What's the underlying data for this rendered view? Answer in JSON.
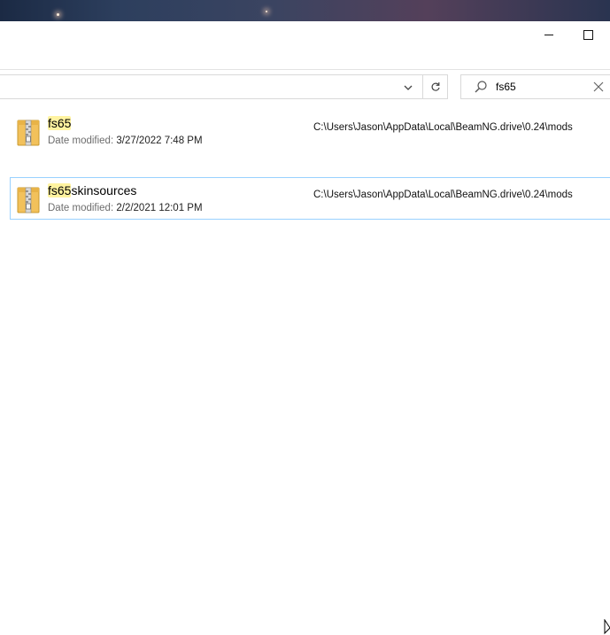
{
  "colors": {
    "highlight": "#fff3a0",
    "selection_border": "#99d1ff",
    "label_gray": "#6d6d6d"
  },
  "window_controls": {
    "minimize_icon": "minimize-icon",
    "maximize_icon": "maximize-icon"
  },
  "address_bar": {
    "chevron_icon": "chevron-down-icon",
    "refresh_icon": "refresh-icon"
  },
  "search": {
    "value": "fs65",
    "icon": "search-icon",
    "clear_icon": "close-icon"
  },
  "results": [
    {
      "name_match": "fs65",
      "name_rest": "",
      "date_label": "Date modified:",
      "date_value": "3/27/2022 7:48 PM",
      "path": "C:\\Users\\Jason\\AppData\\Local\\BeamNG.drive\\0.24\\mods",
      "icon": "zip-folder-icon",
      "selected": false
    },
    {
      "name_match": "fs65",
      "name_rest": "skinsources",
      "date_label": "Date modified:",
      "date_value": "2/2/2021 12:01 PM",
      "path": "C:\\Users\\Jason\\AppData\\Local\\BeamNG.drive\\0.24\\mods",
      "icon": "zip-folder-icon",
      "selected": true
    }
  ]
}
